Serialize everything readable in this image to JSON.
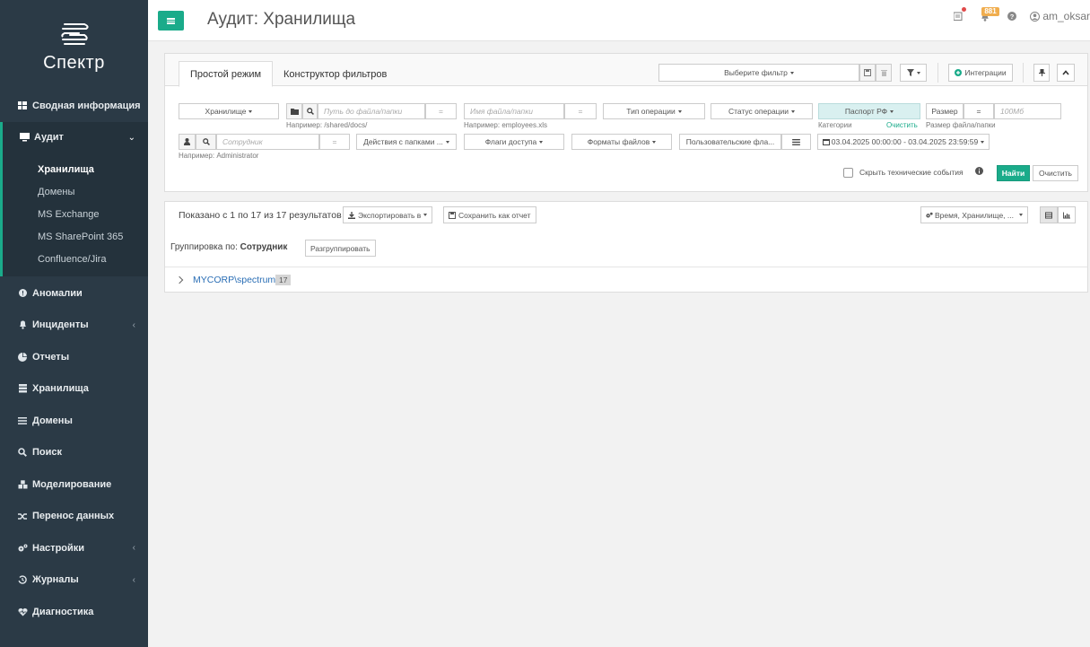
{
  "app": {
    "brand": "Спектр",
    "page_title": "Аудит: Хранилища",
    "notifications_count": "881",
    "username": "am_oksar"
  },
  "sidebar": {
    "items": [
      {
        "label": "Сводная информация",
        "icon": "dashboard-icon"
      },
      {
        "label": "Аудит",
        "icon": "monitor-icon"
      },
      {
        "label": "Аномалии",
        "icon": "exclamation-icon"
      },
      {
        "label": "Инциденты",
        "icon": "bell-icon"
      },
      {
        "label": "Отчеты",
        "icon": "pie-chart-icon"
      },
      {
        "label": "Хранилища",
        "icon": "storage-icon"
      },
      {
        "label": "Домены",
        "icon": "list-icon"
      },
      {
        "label": "Поиск",
        "icon": "search-icon"
      },
      {
        "label": "Моделирование",
        "icon": "cubes-icon"
      },
      {
        "label": "Перенос данных",
        "icon": "shuffle-icon"
      },
      {
        "label": "Настройки",
        "icon": "gears-icon"
      },
      {
        "label": "Журналы",
        "icon": "history-icon"
      },
      {
        "label": "Диагностика",
        "icon": "heartbeat-icon"
      }
    ],
    "audit_sub": [
      "Хранилища",
      "Домены",
      "MS Exchange",
      "MS SharePoint 365",
      "Confluence/Jira"
    ]
  },
  "filters": {
    "tab_simple": "Простой режим",
    "tab_builder": "Конструктор фильтров",
    "choose_filter": "Выберите фильтр",
    "integrations": "Интеграции",
    "storage": "Хранилище",
    "path_placeholder": "Путь до файла/папки",
    "path_hint": "Например: /shared/docs/",
    "filename_placeholder": "Имя файла/папки",
    "filename_hint": "Например: employees.xls",
    "op_type": "Тип операции",
    "op_status": "Статус операции",
    "passport": "Паспорт РФ",
    "categories": "Категории",
    "clear_link": "Очистить",
    "size_label": "Размер",
    "size_op": "=",
    "size_placeholder": "100Мб",
    "size_hint": "Размер файла/папки",
    "employee_placeholder": "Сотрудник",
    "employee_hint": "Например: Administrator",
    "folder_actions": "Действия с папками ...",
    "access_flags": "Флаги доступа",
    "file_formats": "Форматы файлов",
    "user_flags": "Пользовательские фла...",
    "date_range": "03.04.2025 00:00:00 - 03.04.2025 23:59:59",
    "hide_tech": "Скрыть технические события",
    "find": "Найти",
    "clear": "Очистить"
  },
  "results": {
    "summary": "Показано с 1 по 17 из 17 результатов",
    "export": "Экспортировать в",
    "save_report": "Сохранить как отчет",
    "columns": "Время, Хранилище, ...",
    "grouping_label": "Группировка по: ",
    "grouping_value": "Сотрудник",
    "ungroup": "Разгруппировать",
    "group_name": "MYCORP\\spectrum",
    "group_count": "17"
  },
  "colors": {
    "accent": "#1aab8a",
    "sidebar": "#2b3a46",
    "link": "#2a6eb5",
    "badge": "#f0ad4e"
  }
}
